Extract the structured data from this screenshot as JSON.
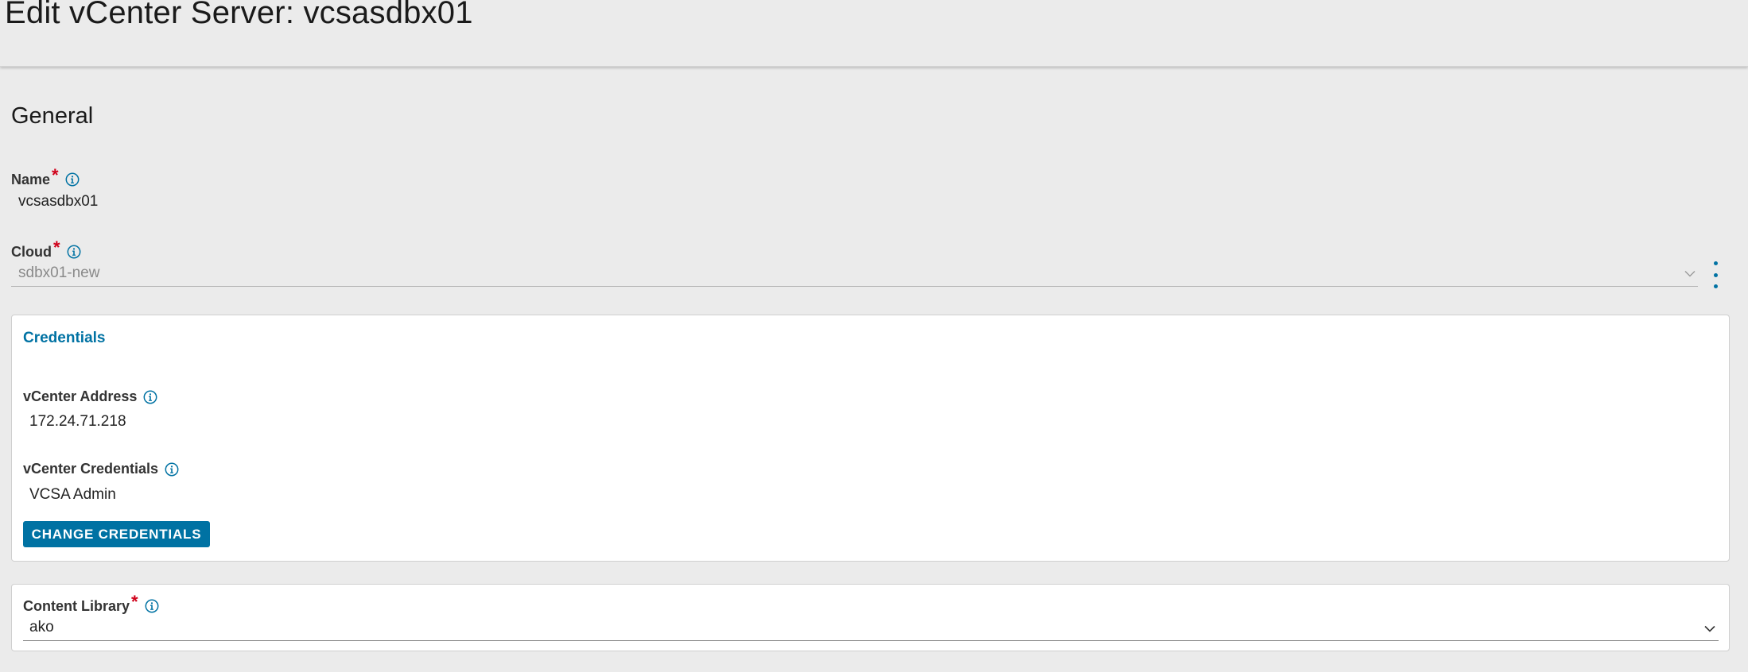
{
  "header": {
    "title": "Edit vCenter Server: vcsasdbx01"
  },
  "general": {
    "section_title": "General",
    "name": {
      "label": "Name",
      "required_marker": "*",
      "value": "vcsasdbx01"
    },
    "cloud": {
      "label": "Cloud",
      "required_marker": "*",
      "value": "sdbx01-new"
    }
  },
  "credentials": {
    "title": "Credentials",
    "vcenter_address": {
      "label": "vCenter Address",
      "value": "172.24.71.218"
    },
    "vcenter_credentials": {
      "label": "vCenter Credentials",
      "value": "VCSA Admin"
    },
    "change_button_label": "CHANGE CREDENTIALS"
  },
  "content_library": {
    "label": "Content Library",
    "required_marker": "*",
    "value": "ako"
  },
  "icons": {
    "info": "info-circle-icon",
    "dropdown": "chevron-down-icon",
    "more": "vertical-ellipsis-icon"
  },
  "colors": {
    "accent": "#0072a3",
    "required": "#d0021b",
    "background": "#ebebeb",
    "card": "#ffffff"
  }
}
